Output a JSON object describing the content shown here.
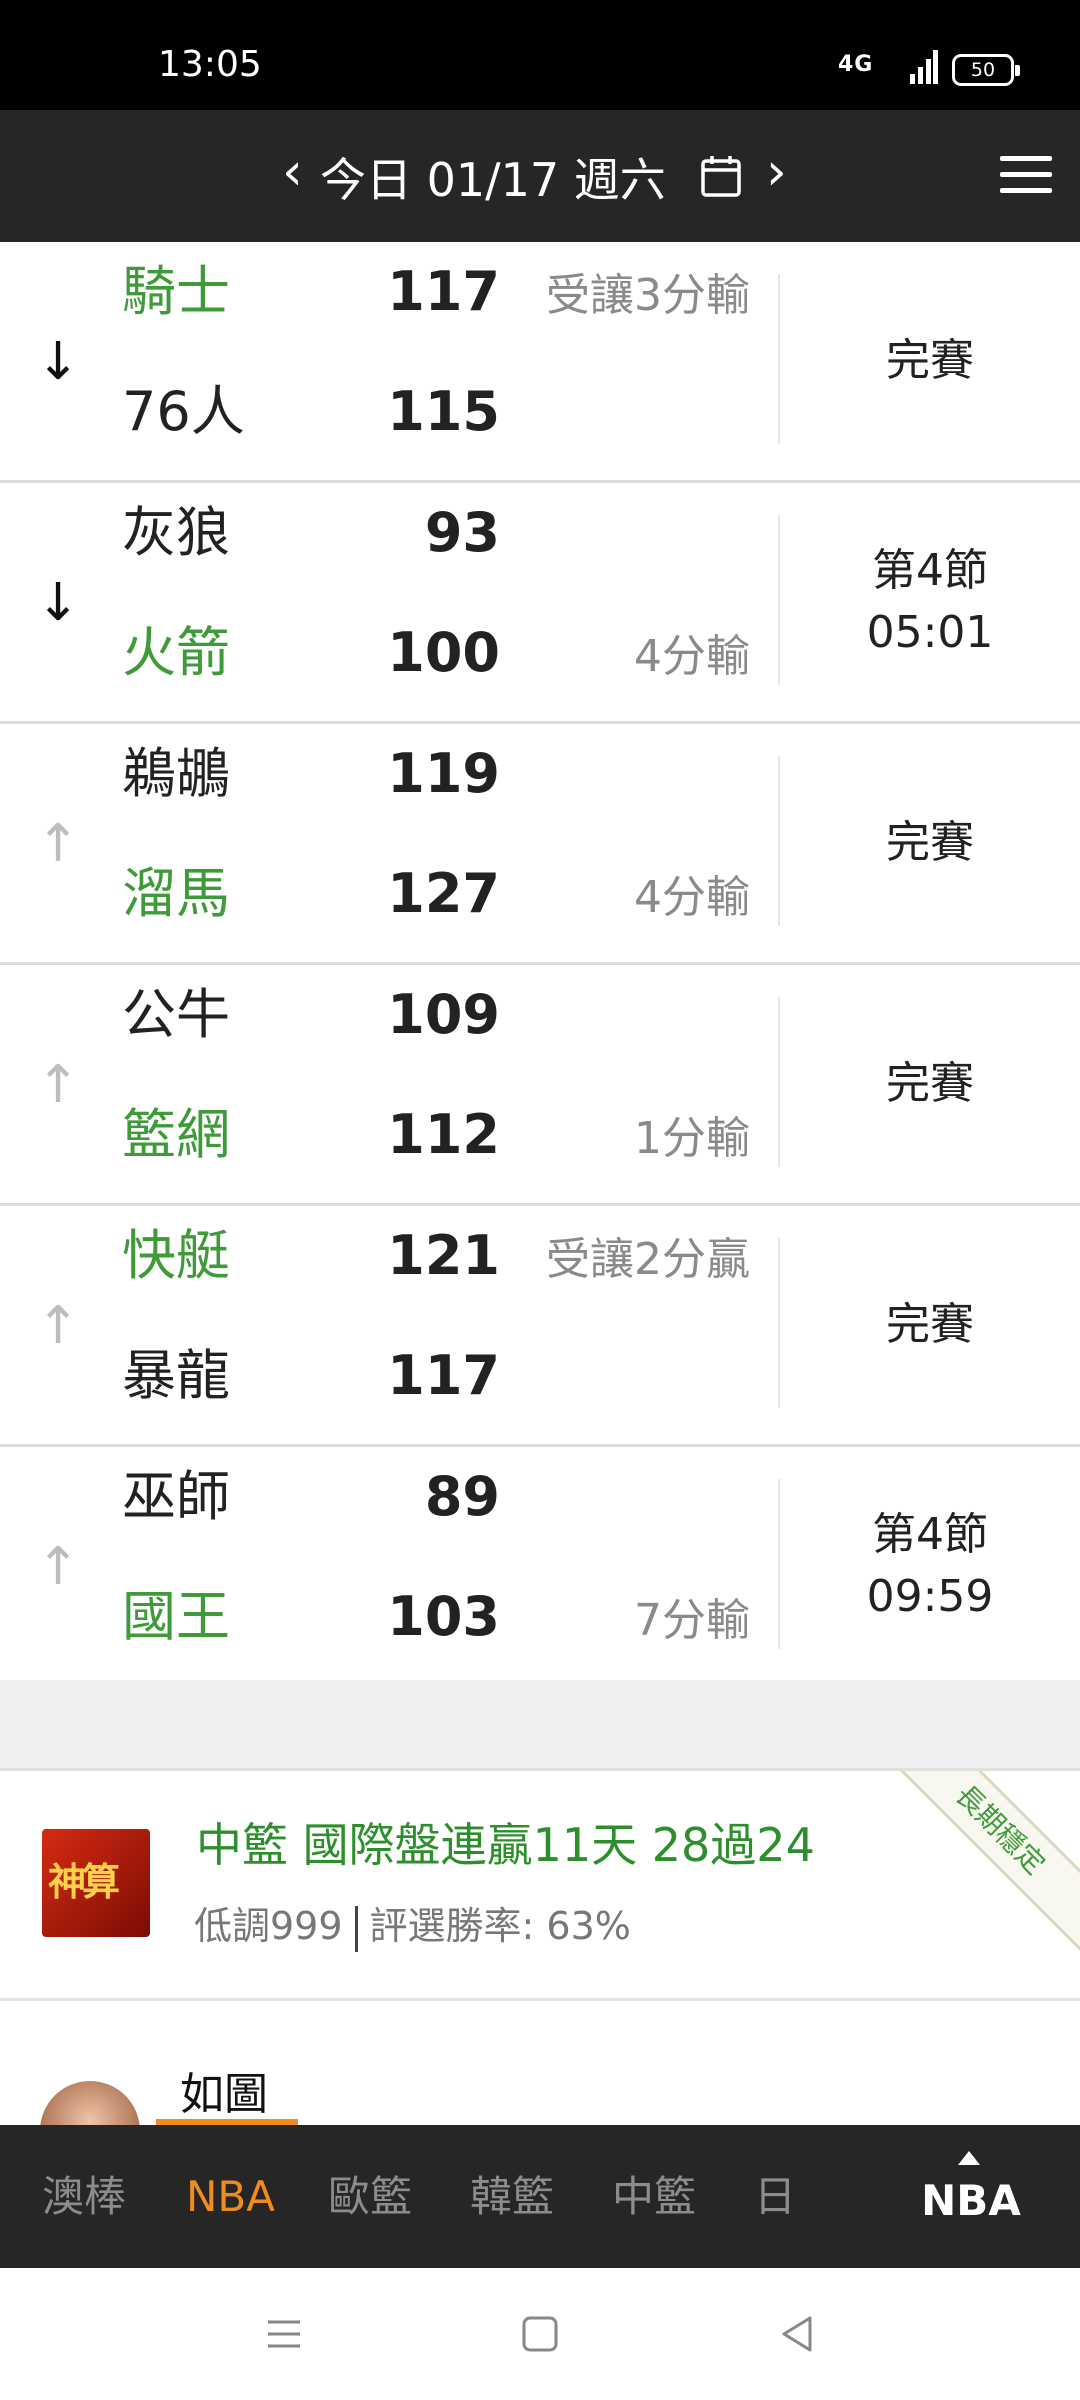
{
  "status_bar": {
    "time": "13:05",
    "network": "4G",
    "battery": "50"
  },
  "header": {
    "date": "今日 01/17 週六",
    "prev_icon": "chevron-left-icon",
    "next_icon": "chevron-right-icon",
    "calendar_icon": "calendar-icon",
    "menu_icon": "hamburger-menu-icon"
  },
  "games": [
    {
      "trend": "down",
      "team1": "騎士",
      "score1": "117",
      "team1_green": true,
      "team2": "76人",
      "score2": "115",
      "team2_green": false,
      "note1": "受讓3分輸",
      "note2": "",
      "status_line1": "完賽",
      "status_line2": ""
    },
    {
      "trend": "down",
      "team1": "灰狼",
      "score1": "93",
      "team1_green": false,
      "team2": "火箭",
      "score2": "100",
      "team2_green": true,
      "note1": "",
      "note2": "4分輸",
      "status_line1": "第4節",
      "status_line2": "05:01"
    },
    {
      "trend": "up",
      "team1": "鵜鶘",
      "score1": "119",
      "team1_green": false,
      "team2": "溜馬",
      "score2": "127",
      "team2_green": true,
      "note1": "",
      "note2": "4分輸",
      "status_line1": "完賽",
      "status_line2": ""
    },
    {
      "trend": "up",
      "team1": "公牛",
      "score1": "109",
      "team1_green": false,
      "team2": "籃網",
      "score2": "112",
      "team2_green": true,
      "note1": "",
      "note2": "1分輸",
      "status_line1": "完賽",
      "status_line2": ""
    },
    {
      "trend": "up",
      "team1": "快艇",
      "score1": "121",
      "team1_green": true,
      "team2": "暴龍",
      "score2": "117",
      "team2_green": false,
      "note1": "受讓2分贏",
      "note2": "",
      "status_line1": "完賽",
      "status_line2": ""
    },
    {
      "trend": "up",
      "team1": "巫師",
      "score1": "89",
      "team1_green": false,
      "team2": "國王",
      "score2": "103",
      "team2_green": true,
      "note1": "",
      "note2": "7分輸",
      "status_line1": "第4節",
      "status_line2": "09:59"
    }
  ],
  "promo": {
    "title": "中籃 國際盤連贏11天 28過24",
    "author": "低調999",
    "win_rate": "評選勝率: 63%",
    "ribbon": "長期穩定",
    "logo_text": "神算"
  },
  "post": {
    "label": "如圖"
  },
  "tabs": [
    {
      "label": "澳棒",
      "active": false
    },
    {
      "label": "NBA",
      "active": true
    },
    {
      "label": "歐籃",
      "active": false
    },
    {
      "label": "韓籃",
      "active": false
    },
    {
      "label": "中籃",
      "active": false
    },
    {
      "label": "日",
      "active": false
    }
  ],
  "current_league": "NBA",
  "colors": {
    "green": "#3f9b3a",
    "orange": "#f08c1e",
    "header_bg": "#262626"
  }
}
